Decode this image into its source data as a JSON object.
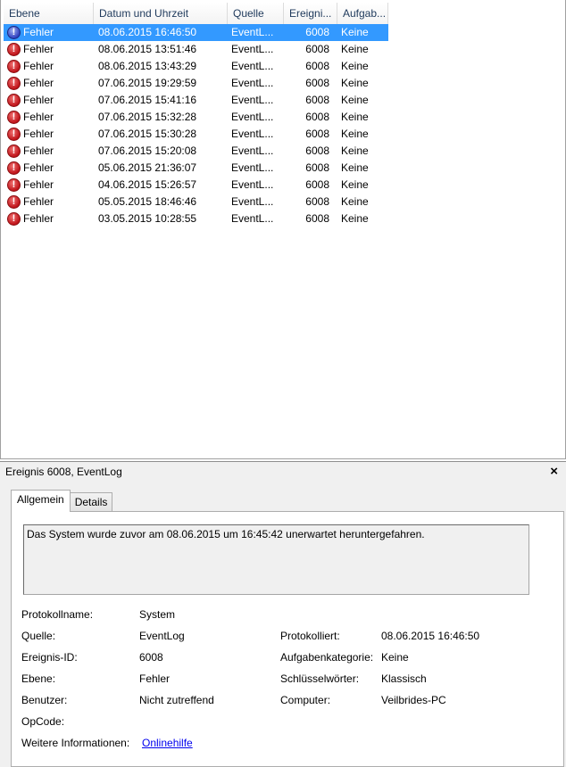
{
  "columns": [
    "Ebene",
    "Datum und Uhrzeit",
    "Quelle",
    "Ereigni...",
    "Aufgab..."
  ],
  "events": [
    {
      "level": "Fehler",
      "datetime": "08.06.2015 16:46:50",
      "source": "EventL...",
      "id": "6008",
      "task": "Keine"
    },
    {
      "level": "Fehler",
      "datetime": "08.06.2015 13:51:46",
      "source": "EventL...",
      "id": "6008",
      "task": "Keine"
    },
    {
      "level": "Fehler",
      "datetime": "08.06.2015 13:43:29",
      "source": "EventL...",
      "id": "6008",
      "task": "Keine"
    },
    {
      "level": "Fehler",
      "datetime": "07.06.2015 19:29:59",
      "source": "EventL...",
      "id": "6008",
      "task": "Keine"
    },
    {
      "level": "Fehler",
      "datetime": "07.06.2015 15:41:16",
      "source": "EventL...",
      "id": "6008",
      "task": "Keine"
    },
    {
      "level": "Fehler",
      "datetime": "07.06.2015 15:32:28",
      "source": "EventL...",
      "id": "6008",
      "task": "Keine"
    },
    {
      "level": "Fehler",
      "datetime": "07.06.2015 15:30:28",
      "source": "EventL...",
      "id": "6008",
      "task": "Keine"
    },
    {
      "level": "Fehler",
      "datetime": "07.06.2015 15:20:08",
      "source": "EventL...",
      "id": "6008",
      "task": "Keine"
    },
    {
      "level": "Fehler",
      "datetime": "05.06.2015 21:36:07",
      "source": "EventL...",
      "id": "6008",
      "task": "Keine"
    },
    {
      "level": "Fehler",
      "datetime": "04.06.2015 15:26:57",
      "source": "EventL...",
      "id": "6008",
      "task": "Keine"
    },
    {
      "level": "Fehler",
      "datetime": "05.05.2015 18:46:46",
      "source": "EventL...",
      "id": "6008",
      "task": "Keine"
    },
    {
      "level": "Fehler",
      "datetime": "03.05.2015 10:28:55",
      "source": "EventL...",
      "id": "6008",
      "task": "Keine"
    }
  ],
  "selected_index": 0,
  "icon": "error-icon",
  "colors": {
    "selection": "#3399ff",
    "link": "#0000ee"
  },
  "detail": {
    "title": "Ereignis 6008, EventLog",
    "close": "×",
    "tabs": [
      "Allgemein",
      "Details"
    ],
    "active_tab": "Allgemein",
    "message": "Das System wurde zuvor am 08.06.2015 um 16:45:42 unerwartet heruntergefahren.",
    "labels": {
      "protokollname": "Protokollname:",
      "quelle": "Quelle:",
      "ereignis_id": "Ereignis-ID:",
      "ebene": "Ebene:",
      "benutzer": "Benutzer:",
      "opcode": "OpCode:",
      "weitere": "Weitere Informationen:",
      "protokolliert": "Protokolliert:",
      "aufgabenkategorie": "Aufgabenkategorie:",
      "schluesselwoerter": "Schlüsselwörter:",
      "computer": "Computer:"
    },
    "values": {
      "protokollname": "System",
      "quelle": "EventLog",
      "ereignis_id": "6008",
      "ebene": "Fehler",
      "benutzer": "Nicht zutreffend",
      "opcode": "",
      "weitere": "Onlinehilfe",
      "protokolliert": "08.06.2015 16:46:50",
      "aufgabenkategorie": "Keine",
      "schluesselwoerter": "Klassisch",
      "computer": "Veilbrides-PC"
    }
  }
}
